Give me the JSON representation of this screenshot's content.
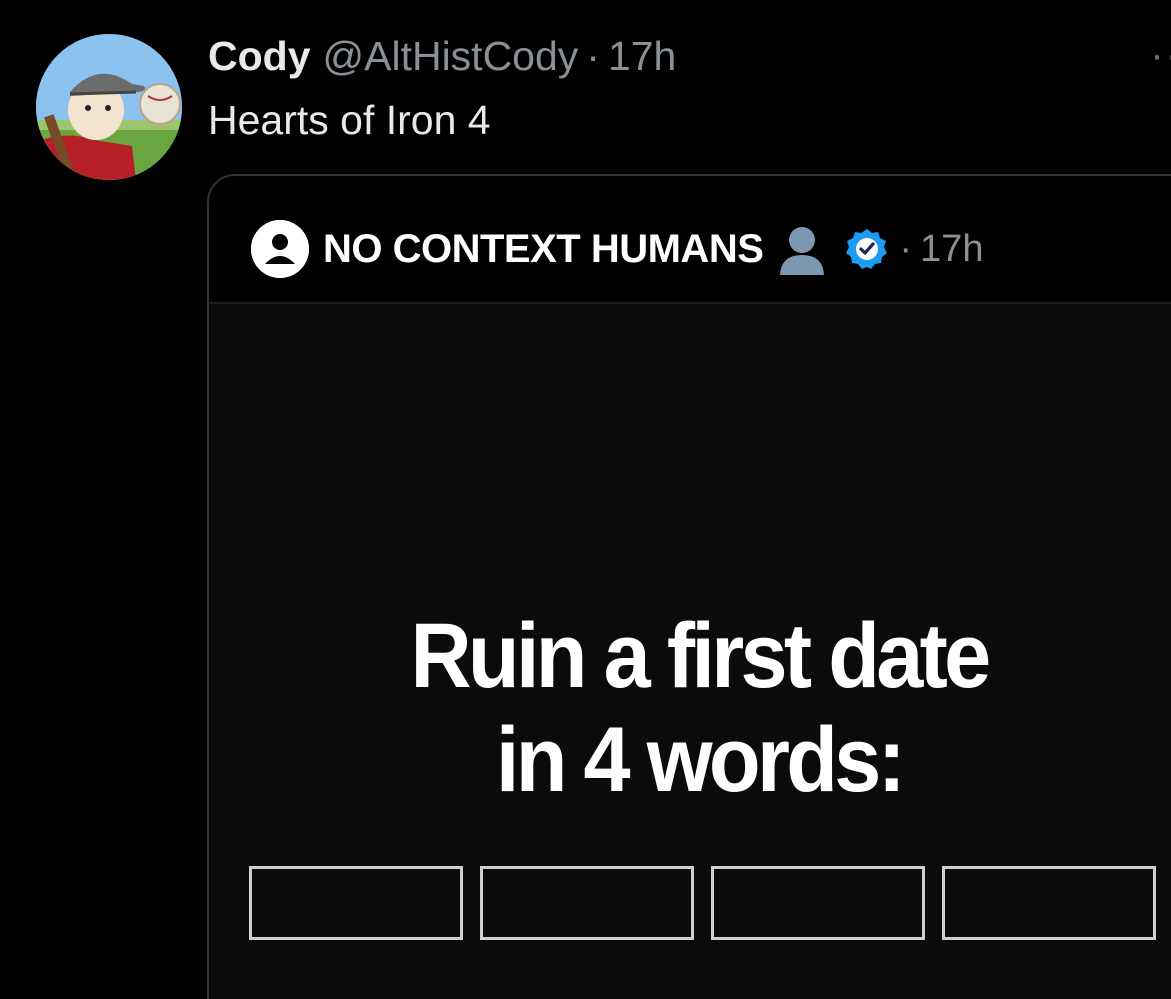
{
  "tweet": {
    "display_name": "Cody",
    "handle": "@AltHistCody",
    "separator": "·",
    "time": "17h",
    "text": "Hearts of Iron 4",
    "more_menu": "··"
  },
  "quoted_tweet": {
    "name": "NO CONTEXT HUMANS",
    "emoji": "bust-in-silhouette",
    "separator": "·",
    "time": "17h",
    "media": {
      "headline_line1": "Ruin a first date",
      "headline_line2": "in 4 words:",
      "blank_boxes": 4
    }
  },
  "colors": {
    "background": "#000000",
    "text_primary": "#e7e9ea",
    "text_secondary": "#8b9096",
    "border": "#2f3336",
    "verified_blue": "#1d9bf0"
  }
}
